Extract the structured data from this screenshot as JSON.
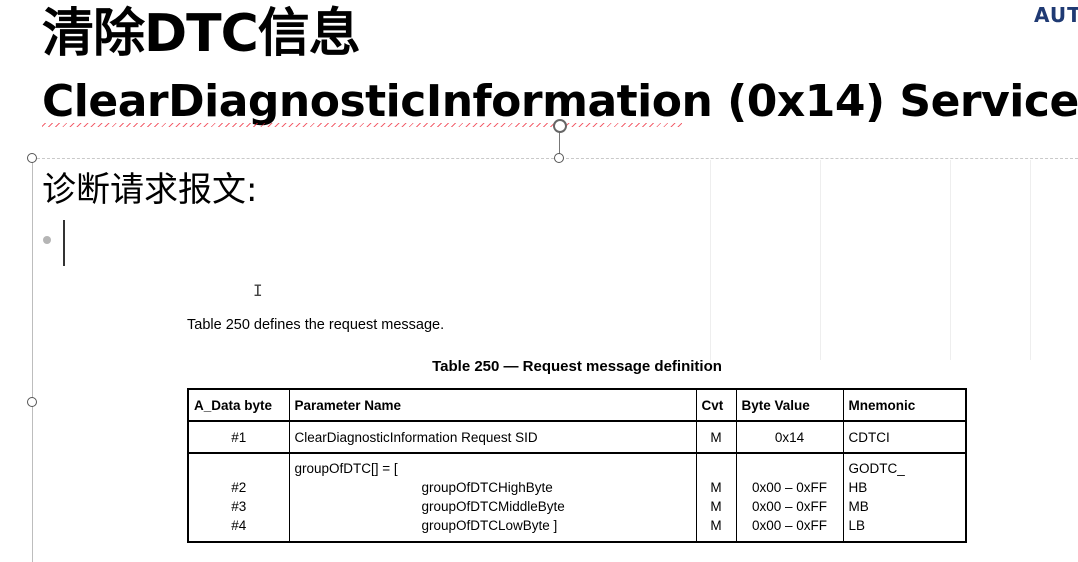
{
  "slide": {
    "title_cn": "清除DTC信息",
    "title_en": "ClearDiagnosticInformation (0x14) Service",
    "brand": "AUTO",
    "subheading": "诊断请求报文:",
    "ibeam_glyph": "I"
  },
  "document": {
    "intro": "Table 250 defines the request message.",
    "caption": "Table 250 — Request message definition",
    "headers": [
      "A_Data byte",
      "Parameter Name",
      "Cvt",
      "Byte Value",
      "Mnemonic"
    ],
    "row1": {
      "byte": "#1",
      "name": "ClearDiagnosticInformation Request SID",
      "cvt": "M",
      "value": "0x14",
      "mnemonic": "CDTCI"
    },
    "group": {
      "name": "groupOfDTC[] = [",
      "mnemonic": "GODTC_",
      "items": [
        {
          "byte": "#2",
          "name": "groupOfDTCHighByte",
          "cvt": "M",
          "value": "0x00 – 0xFF",
          "mnemonic": "HB"
        },
        {
          "byte": "#3",
          "name": "groupOfDTCMiddleByte",
          "cvt": "M",
          "value": "0x00 – 0xFF",
          "mnemonic": "MB"
        },
        {
          "byte": "#4",
          "name": "groupOfDTCLowByte ]",
          "cvt": "M",
          "value": "0x00 – 0xFF",
          "mnemonic": "LB"
        }
      ]
    }
  }
}
